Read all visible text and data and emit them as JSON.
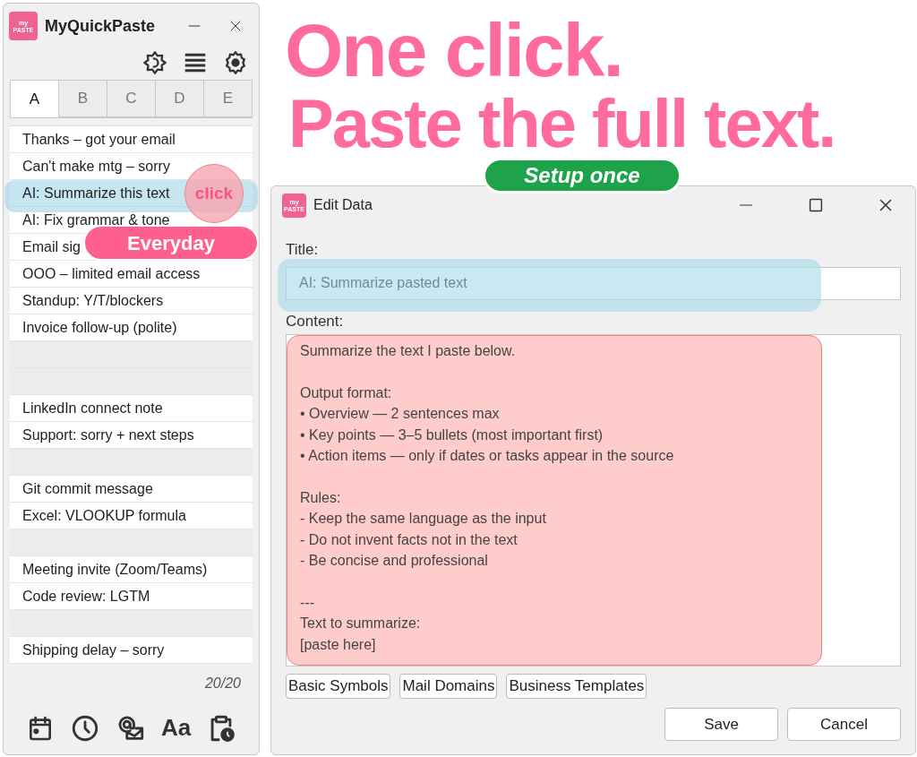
{
  "headline": {
    "lines": [
      "One click.",
      "Paste the full text."
    ],
    "badge": "Setup once"
  },
  "main_window": {
    "logo": [
      "my",
      "PASTE"
    ],
    "title": "MyQuickPaste",
    "tabs": [
      {
        "label": "A",
        "selected": true
      },
      {
        "label": "B",
        "selected": false
      },
      {
        "label": "C",
        "selected": false
      },
      {
        "label": "D",
        "selected": false
      },
      {
        "label": "E",
        "selected": false
      }
    ],
    "items": [
      {
        "kind": "entry",
        "text": "Thanks – got your email",
        "selected": false
      },
      {
        "kind": "entry",
        "text": "Can't make mtg – sorry",
        "selected": false
      },
      {
        "kind": "entry",
        "text": "AI: Summarize this text",
        "selected": true
      },
      {
        "kind": "entry",
        "text": "AI: Fix grammar & tone",
        "selected": false
      },
      {
        "kind": "entry",
        "text": "Email sig",
        "selected": false
      },
      {
        "kind": "entry",
        "text": "OOO – limited email access",
        "selected": false
      },
      {
        "kind": "entry",
        "text": "Standup: Y/T/blockers",
        "selected": false
      },
      {
        "kind": "entry",
        "text": "Invoice follow-up (polite)",
        "selected": false
      },
      {
        "kind": "empty"
      },
      {
        "kind": "empty"
      },
      {
        "kind": "entry",
        "text": "LinkedIn connect note",
        "selected": false
      },
      {
        "kind": "entry",
        "text": "Support: sorry + next steps",
        "selected": false
      },
      {
        "kind": "empty"
      },
      {
        "kind": "entry",
        "text": "Git commit message",
        "selected": false
      },
      {
        "kind": "entry",
        "text": "Excel: VLOOKUP formula",
        "selected": false
      },
      {
        "kind": "empty"
      },
      {
        "kind": "entry",
        "text": "Meeting invite (Zoom/Teams)",
        "selected": false
      },
      {
        "kind": "entry",
        "text": "Code review: LGTM",
        "selected": false
      },
      {
        "kind": "empty"
      },
      {
        "kind": "entry",
        "text": "Shipping delay – sorry",
        "selected": false
      }
    ],
    "counter": "20/20",
    "font_button": "Aa",
    "click_mark": "click",
    "everyday_badge": "Everyday"
  },
  "edit_window": {
    "logo": [
      "my",
      "PASTE"
    ],
    "title": "Edit Data",
    "title_label": "Title:",
    "title_value": "AI: Summarize pasted text",
    "content_label": "Content:",
    "content": "Summarize the text I paste below.\n\nOutput format:\n• Overview — 2 sentences max\n• Key points — 3–5 bullets (most important first)\n• Action items — only if dates or tasks appear in the source\n\nRules:\n- Keep the same language as the input\n- Do not invent facts not in the text\n- Be concise and professional\n\n---\nText to summarize:\n[paste here]",
    "template_buttons": [
      "Basic Symbols",
      "Mail Domains",
      "Business Templates"
    ],
    "buttons": [
      "Save",
      "Cancel"
    ]
  }
}
